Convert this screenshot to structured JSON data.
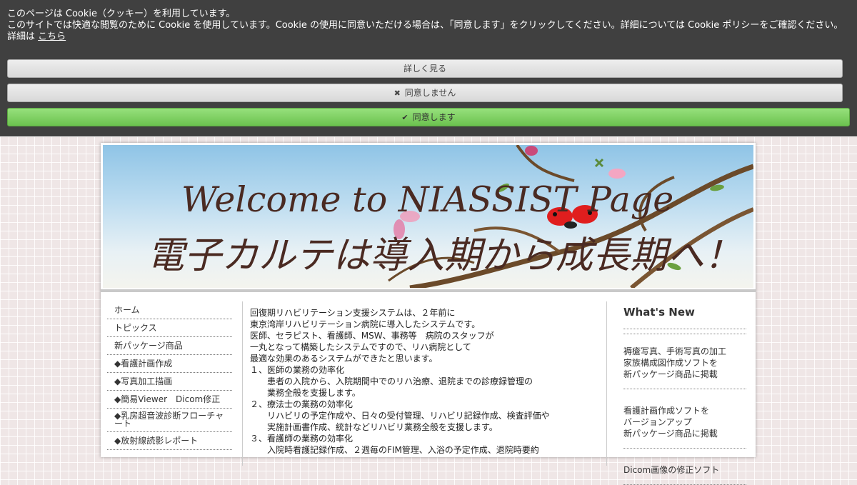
{
  "cookie": {
    "line1": "このページは Cookie（クッキー）を利用しています。",
    "line2": "このサイトでは快適な閲覧のために Cookie を使用しています。Cookie の使用に同意いただける場合は、「同意します」をクリックしてください。詳細については Cookie ポリシーをご確認ください。",
    "line3_prefix": "詳細は",
    "line3_link": "こちら",
    "details_button": "詳しく見る",
    "decline_button": "同意しません",
    "decline_icon": "✖",
    "agree_button": "同意します",
    "agree_icon": "✔",
    "colors": {
      "banner": "#3a3a3a",
      "agree": "#7ed360"
    }
  },
  "header": {
    "title": "Welcome to NIASSIST Page",
    "subtitle": "電子カルテは導入期から成長期へ！"
  },
  "nav": {
    "items": [
      "ホーム",
      "トピックス",
      "新パッケージ商品",
      "◆看護計画作成",
      "◆写真加工描画",
      "◆簡易Viewer　Dicom修正",
      "◆乳房超音波診断フローチャート",
      "◆放射線読影レポート"
    ]
  },
  "content": {
    "lines": [
      "回復期リハビリテーション支援システムは、２年前に",
      "東京湾岸リハビリテーション病院に導入したシステムです。",
      "医師、セラピスト、看護師、MSW、事務等　病院のスタッフが",
      "一丸となって構築したシステムですので、リハ病院として",
      "最適な効果のあるシステムができたと思います。",
      "１、医師の業務の効率化",
      "患者の入院から、入院期間中でのリハ治療、退院までの診療録管理の",
      "業務全般を支援します。",
      "２、療法士の業務の効率化",
      "リハビリの予定作成や、日々の受付管理、リハビリ記録作成、検査評価や",
      "実施計画書作成、統計などリハビリ業務全般を支援します。",
      "３、看護師の業務の効率化",
      "入院時看護記録作成、２週毎のFIM管理、入浴の予定作成、退院時要約"
    ]
  },
  "news": {
    "title": "What's New",
    "entries": [
      {
        "l1": "褥瘡写真、手術写真の加工",
        "l2": "家族構成図作成ソフトを",
        "l3": "新パッケージ商品に掲載"
      },
      {
        "l1": "看護計画作成ソフトを",
        "l2": "バージョンアップ",
        "l3": "新パッケージ商品に掲載"
      },
      {
        "l1": "Dicom画像の修正ソフト",
        "l2": "",
        "l3": ""
      }
    ]
  }
}
